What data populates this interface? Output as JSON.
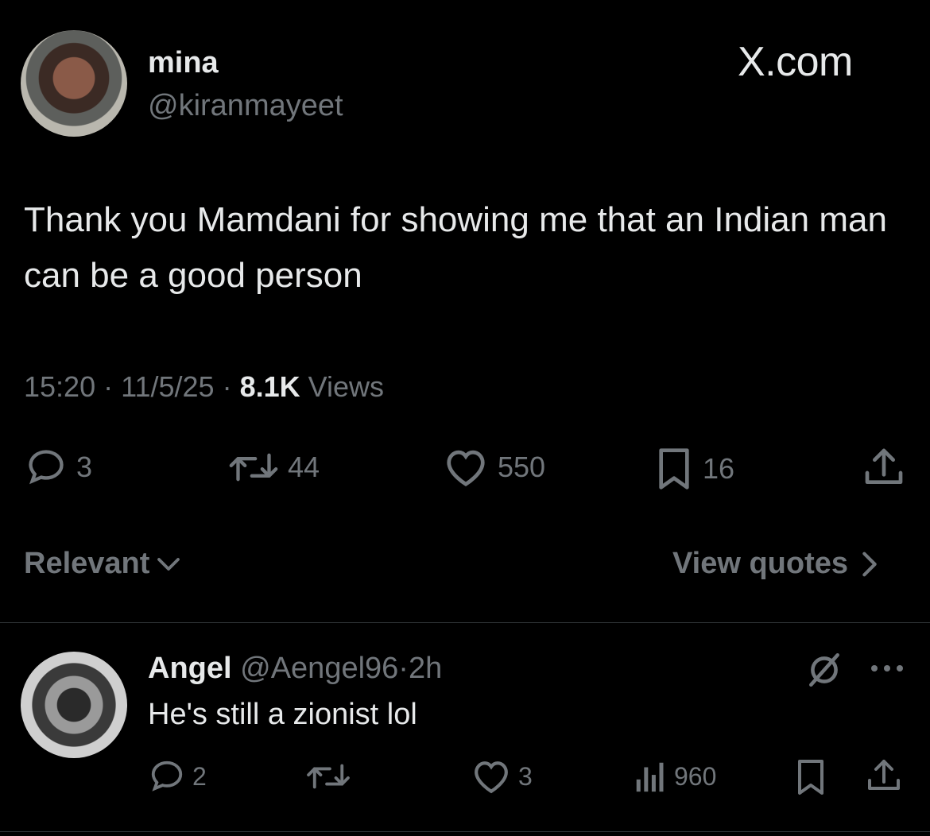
{
  "tweet": {
    "author_name": "mina",
    "author_handle": "@kiranmayeet",
    "brand": "X.com",
    "text": "Thank you Mamdani for showing me that an Indian man can be a good person",
    "time": "15:20",
    "date": "11/5/25",
    "views_count": "8.1K",
    "views_label": "Views",
    "sep": "·",
    "replies": "3",
    "reposts": "44",
    "likes": "550",
    "bookmarks": "16"
  },
  "sort": {
    "label": "Relevant",
    "view_quotes": "View quotes"
  },
  "reply": {
    "author_name": "Angel",
    "author_handle": "@Aengel96",
    "sep": "·",
    "age": "2h",
    "text": "He's still a zionist lol",
    "replies": "2",
    "likes": "3",
    "views": "960"
  },
  "colors": {
    "background": "#000000",
    "text_primary": "#e7e9ea",
    "text_secondary": "#71767b",
    "divider": "#2f3336"
  }
}
